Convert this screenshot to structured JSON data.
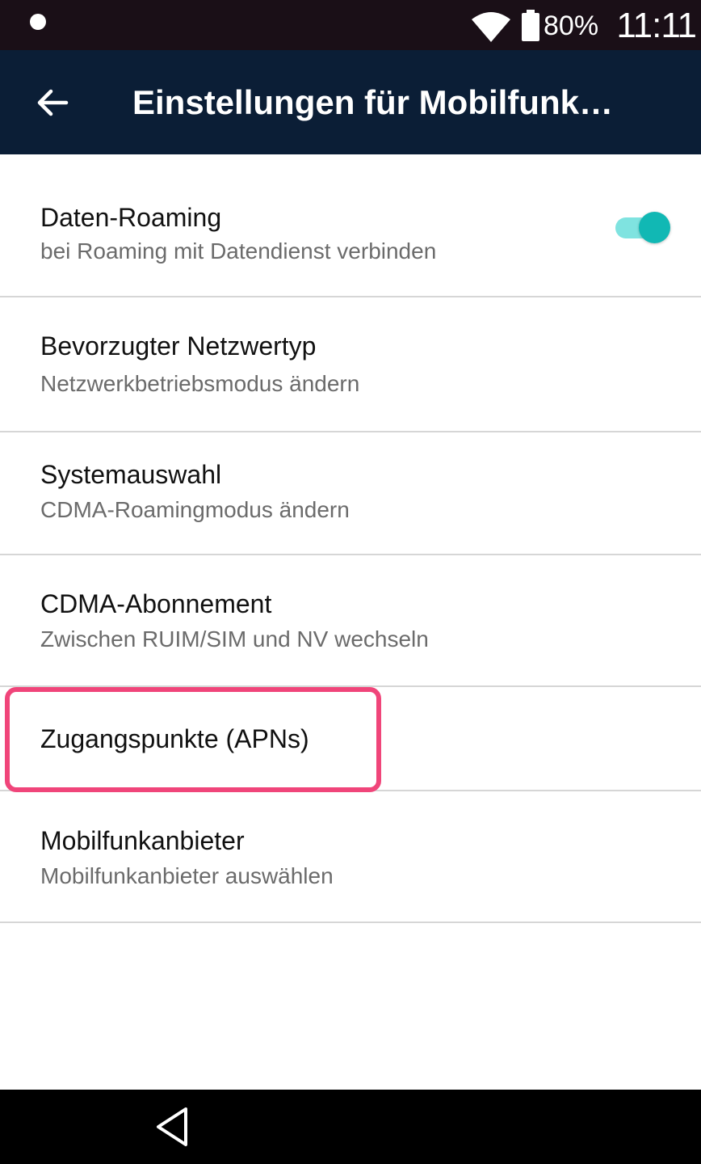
{
  "status_bar": {
    "battery_level": "80%",
    "clock": "11:11",
    "icons": [
      "notification-dot-icon",
      "wifi-icon",
      "battery-icon"
    ]
  },
  "app_bar": {
    "title": "Einstellungen für Mobilfunk…",
    "back_icon": "arrow-left-icon"
  },
  "settings": [
    {
      "title": "Daten-Roaming",
      "subtitle": "bei Roaming mit Datendienst verbinden",
      "toggle": true
    },
    {
      "title": "Bevorzugter Netzwertyp",
      "subtitle": "Netzwerkbetriebsmodus ändern"
    },
    {
      "title": "Systemauswahl",
      "subtitle": "CDMA-Roamingmodus ändern"
    },
    {
      "title": "CDMA-Abonnement",
      "subtitle": "Zwischen RUIM/SIM und NV wechseln"
    },
    {
      "title": "Zugangspunkte (APNs)",
      "subtitle": "",
      "highlighted": true
    },
    {
      "title": "Mobilfunkanbieter",
      "subtitle": "Mobilfunkanbieter auswählen"
    }
  ],
  "colors": {
    "status_bar": "#1a0f17",
    "app_bar": "#0b1e36",
    "toggle_on": "#11b8b4",
    "toggle_track": "#7fe3e0",
    "highlight": "#f0457a"
  },
  "nav_bar": {
    "back_icon": "triangle-back-icon"
  }
}
